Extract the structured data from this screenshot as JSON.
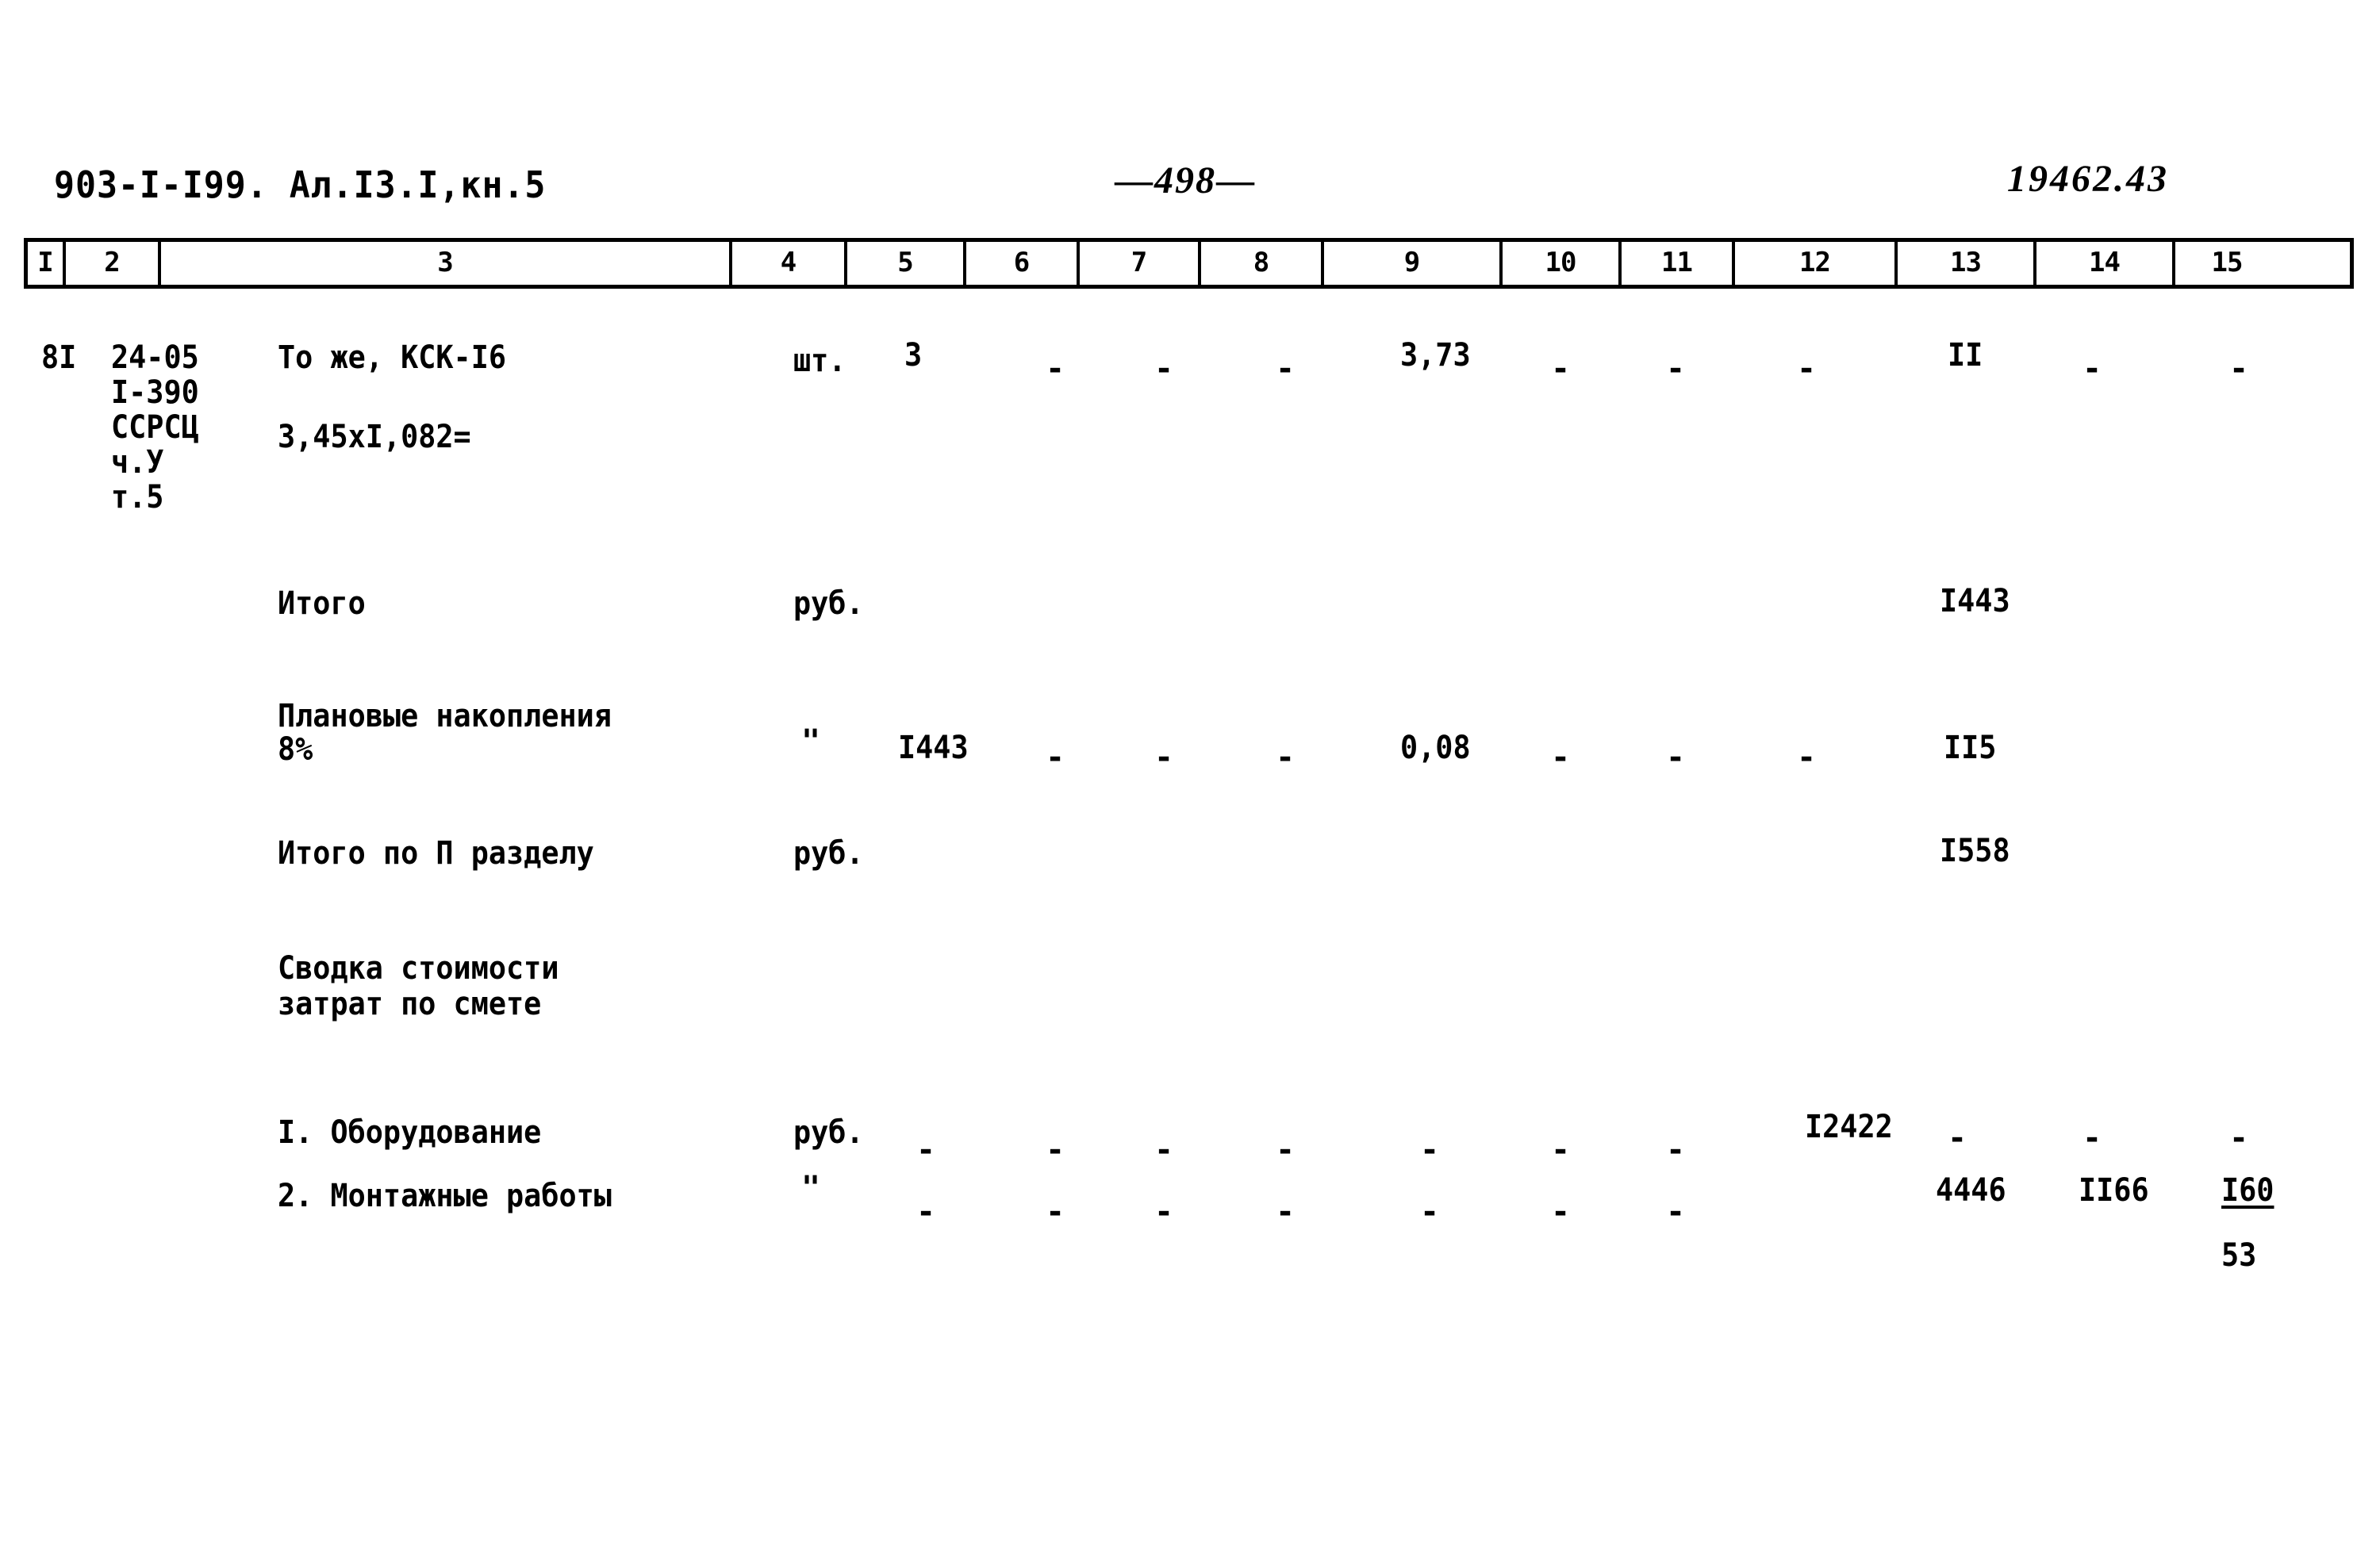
{
  "header": {
    "doc_code": "903-I-I99. Ал.I3.I,кн.5",
    "page_number": "498",
    "page_number_left_dash": "—",
    "page_number_right_dash": "—",
    "hand_code": "19462.43"
  },
  "table": {
    "column_numbers": [
      "I",
      "2",
      "3",
      "4",
      "5",
      "6",
      "7",
      "8",
      "9",
      "10",
      "11",
      "12",
      "13",
      "14",
      "15"
    ],
    "rows": [
      {
        "name": "row-81",
        "col1": "8I",
        "col2_lines": [
          "24-05",
          "I-390",
          "ССРСЦ",
          "ч.У",
          "т.5"
        ],
        "col3_lines": [
          "То же, КСК-I6",
          "3,45xI,082="
        ],
        "col4": "шт.",
        "col5": "3",
        "col6": "-",
        "col7": "-",
        "col8": "-",
        "col9": "3,73",
        "col10": "-",
        "col11": "-",
        "col12": "-",
        "col13": "II",
        "col14": "-",
        "col15": "-"
      },
      {
        "name": "row-itogo",
        "col3": "Итого",
        "col4": "руб.",
        "col13": "I443"
      },
      {
        "name": "row-planovye-nakopleniya",
        "col3_lines": [
          "Плановые накопления",
          "8%"
        ],
        "col4": "\"",
        "col5": "I443",
        "col6": "-",
        "col7": "-",
        "col8": "-",
        "col9": "0,08",
        "col10": "-",
        "col11": "-",
        "col12": "-",
        "col13": "II5"
      },
      {
        "name": "row-itogo-po-razdelu",
        "col3": "Итого по П разделу",
        "col4": "руб.",
        "col13": "I558"
      },
      {
        "name": "row-svodka-title",
        "col3_lines": [
          "Сводка стоимости",
          "затрат по смете"
        ]
      },
      {
        "name": "row-oborudovanie",
        "col3": "I. Оборудование",
        "col4": "руб.",
        "col5": "-",
        "col6": "-",
        "col7": "-",
        "col8": "-",
        "col9": "-",
        "col10": "-",
        "col11": "-",
        "col12": "I2422",
        "col13": "-",
        "col14": "-",
        "col15": "-"
      },
      {
        "name": "row-montazhnye-raboty",
        "col3": "2. Монтажные работы",
        "col4": "\"",
        "col5": "-",
        "col6": "-",
        "col7": "-",
        "col8": "-",
        "col9": "-",
        "col10": "-",
        "col11": "-",
        "col12": "4446",
        "col13": "II66",
        "col14": "I60",
        "col15_overflow": "53"
      }
    ]
  }
}
